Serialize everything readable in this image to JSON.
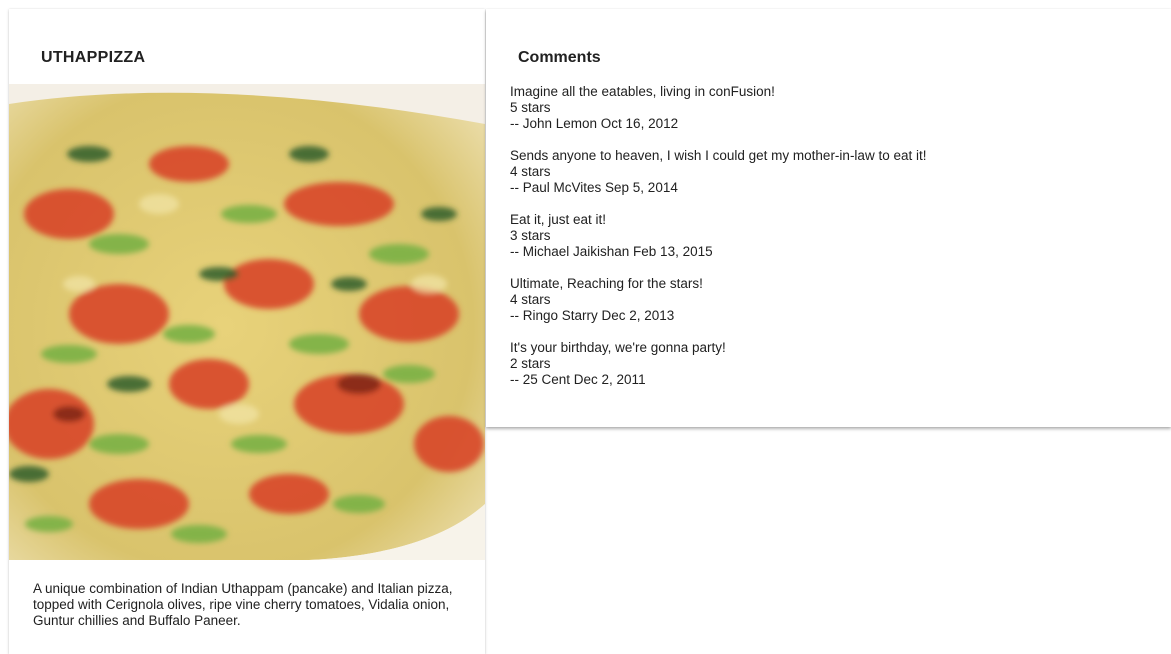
{
  "dish": {
    "name": "UTHAPPIZZA",
    "description": "A unique combination of Indian Uthappam (pancake) and Italian pizza, topped with Cerignola olives, ripe vine cherry tomatoes, Vidalia onion, Guntur chillies and Buffalo Paneer."
  },
  "comments": {
    "heading": "Comments",
    "items": [
      {
        "text": "Imagine all the eatables, living in conFusion!",
        "rating": "5 stars",
        "byline": "-- John Lemon Oct 16, 2012"
      },
      {
        "text": "Sends anyone to heaven, I wish I could get my mother-in-law to eat it!",
        "rating": "4 stars",
        "byline": "-- Paul McVites Sep 5, 2014"
      },
      {
        "text": "Eat it, just eat it!",
        "rating": "3 stars",
        "byline": "-- Michael Jaikishan Feb 13, 2015"
      },
      {
        "text": "Ultimate, Reaching for the stars!",
        "rating": "4 stars",
        "byline": "-- Ringo Starry Dec 2, 2013"
      },
      {
        "text": "It's your birthday, we're gonna party!",
        "rating": "2 stars",
        "byline": "-- 25 Cent Dec 2, 2011"
      }
    ]
  }
}
